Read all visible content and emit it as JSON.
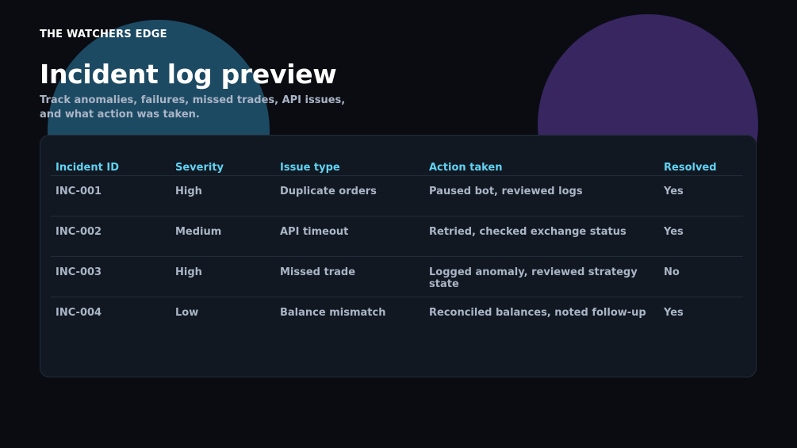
{
  "brand": "THE WATCHERS EDGE",
  "title": "Incident log preview",
  "subtitle": "Track anomalies, failures, missed trades, API issues, and what action was taken.",
  "colors": {
    "background": "#0a0c12",
    "card": "#111822",
    "header_accent": "#5fd3f3",
    "high": "#f38b85",
    "resolved_yes": "#7fd6a0",
    "resolved_no": "#f38b85"
  },
  "table": {
    "columns": [
      "Incident ID",
      "Severity",
      "Issue type",
      "Action taken",
      "Resolved"
    ],
    "rows": [
      [
        "INC-001",
        "High",
        "Duplicate orders",
        "Paused bot, reviewed logs",
        "Yes"
      ],
      [
        "INC-002",
        "Medium",
        "API timeout",
        "Retried, checked exchange status",
        "Yes"
      ],
      [
        "INC-003",
        "High",
        "Missed trade",
        "Logged anomaly, reviewed strategy state",
        "No"
      ],
      [
        "INC-004",
        "Low",
        "Balance mismatch",
        "Reconciled balances, noted follow-up",
        "Yes"
      ]
    ]
  }
}
